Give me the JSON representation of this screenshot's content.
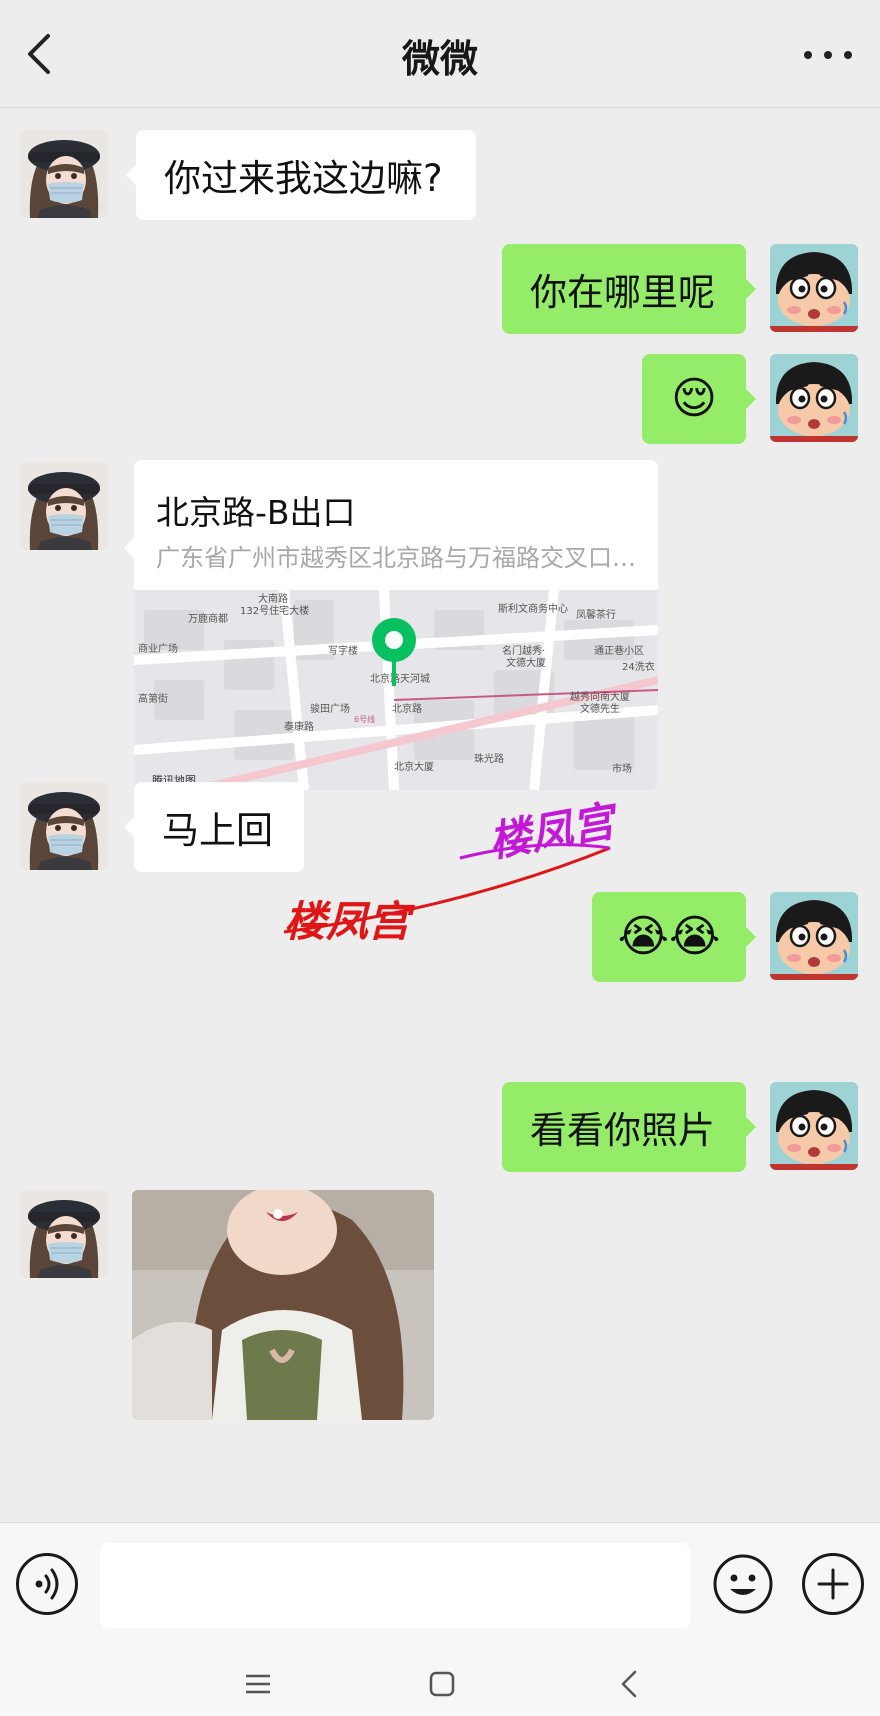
{
  "header": {
    "title": "微微",
    "back_icon": "chevron-left-icon",
    "more_icon": "more-dots-icon"
  },
  "messages": [
    {
      "side": "left",
      "text": "你过来我这边嘛?"
    },
    {
      "side": "right",
      "text": "你在哪里呢"
    },
    {
      "side": "right",
      "text": "😌"
    },
    {
      "side": "left",
      "type": "location",
      "title": "北京路-B出口",
      "address": "广东省广州市越秀区北京路与万福路交叉口东北角",
      "map_brand": "腾讯地图"
    },
    {
      "side": "left",
      "text": "马上回"
    },
    {
      "side": "right",
      "text": "😭😭"
    },
    {
      "side": "right",
      "text": "看看你照片"
    },
    {
      "side": "left",
      "type": "image",
      "description": "photo"
    }
  ],
  "map_labels": {
    "l1": "大南路",
    "l2": "132号住宅大楼",
    "l3": "万鹿商都",
    "l4": "商业广场",
    "l5": "高第街",
    "l6": "写字楼",
    "l7": "斯利文商务中心",
    "l8": "凤馨茶行",
    "l9": "名门越秀·",
    "l10": "文德大厦",
    "l11": "通正巷小区",
    "l12": "24洗衣",
    "l13": "北京路天河城",
    "l14": "北京路",
    "l15": "骏田广场",
    "l16": "泰康路",
    "l17": "越秀向南大厦",
    "l18": "文德先生",
    "l19": "北京大厦",
    "l20": "珠光路",
    "l21": "市场",
    "l22": "6号线",
    "l23": "高第街"
  },
  "watermark": {
    "text1": "楼凤宫",
    "text2": "楼凤宫",
    "color1": "#e01515",
    "color2": "#c418d8"
  },
  "input": {
    "placeholder": "",
    "voice_icon": "voice-icon",
    "emoji_icon": "emoji-icon",
    "plus_icon": "plus-icon"
  },
  "nav": {
    "menu_icon": "menu-icon",
    "home_icon": "home-icon",
    "back_icon": "back-icon"
  },
  "colors": {
    "bg": "#ededed",
    "bubble_green": "#95ec69",
    "bubble_white": "#ffffff",
    "pin": "#07c160"
  }
}
